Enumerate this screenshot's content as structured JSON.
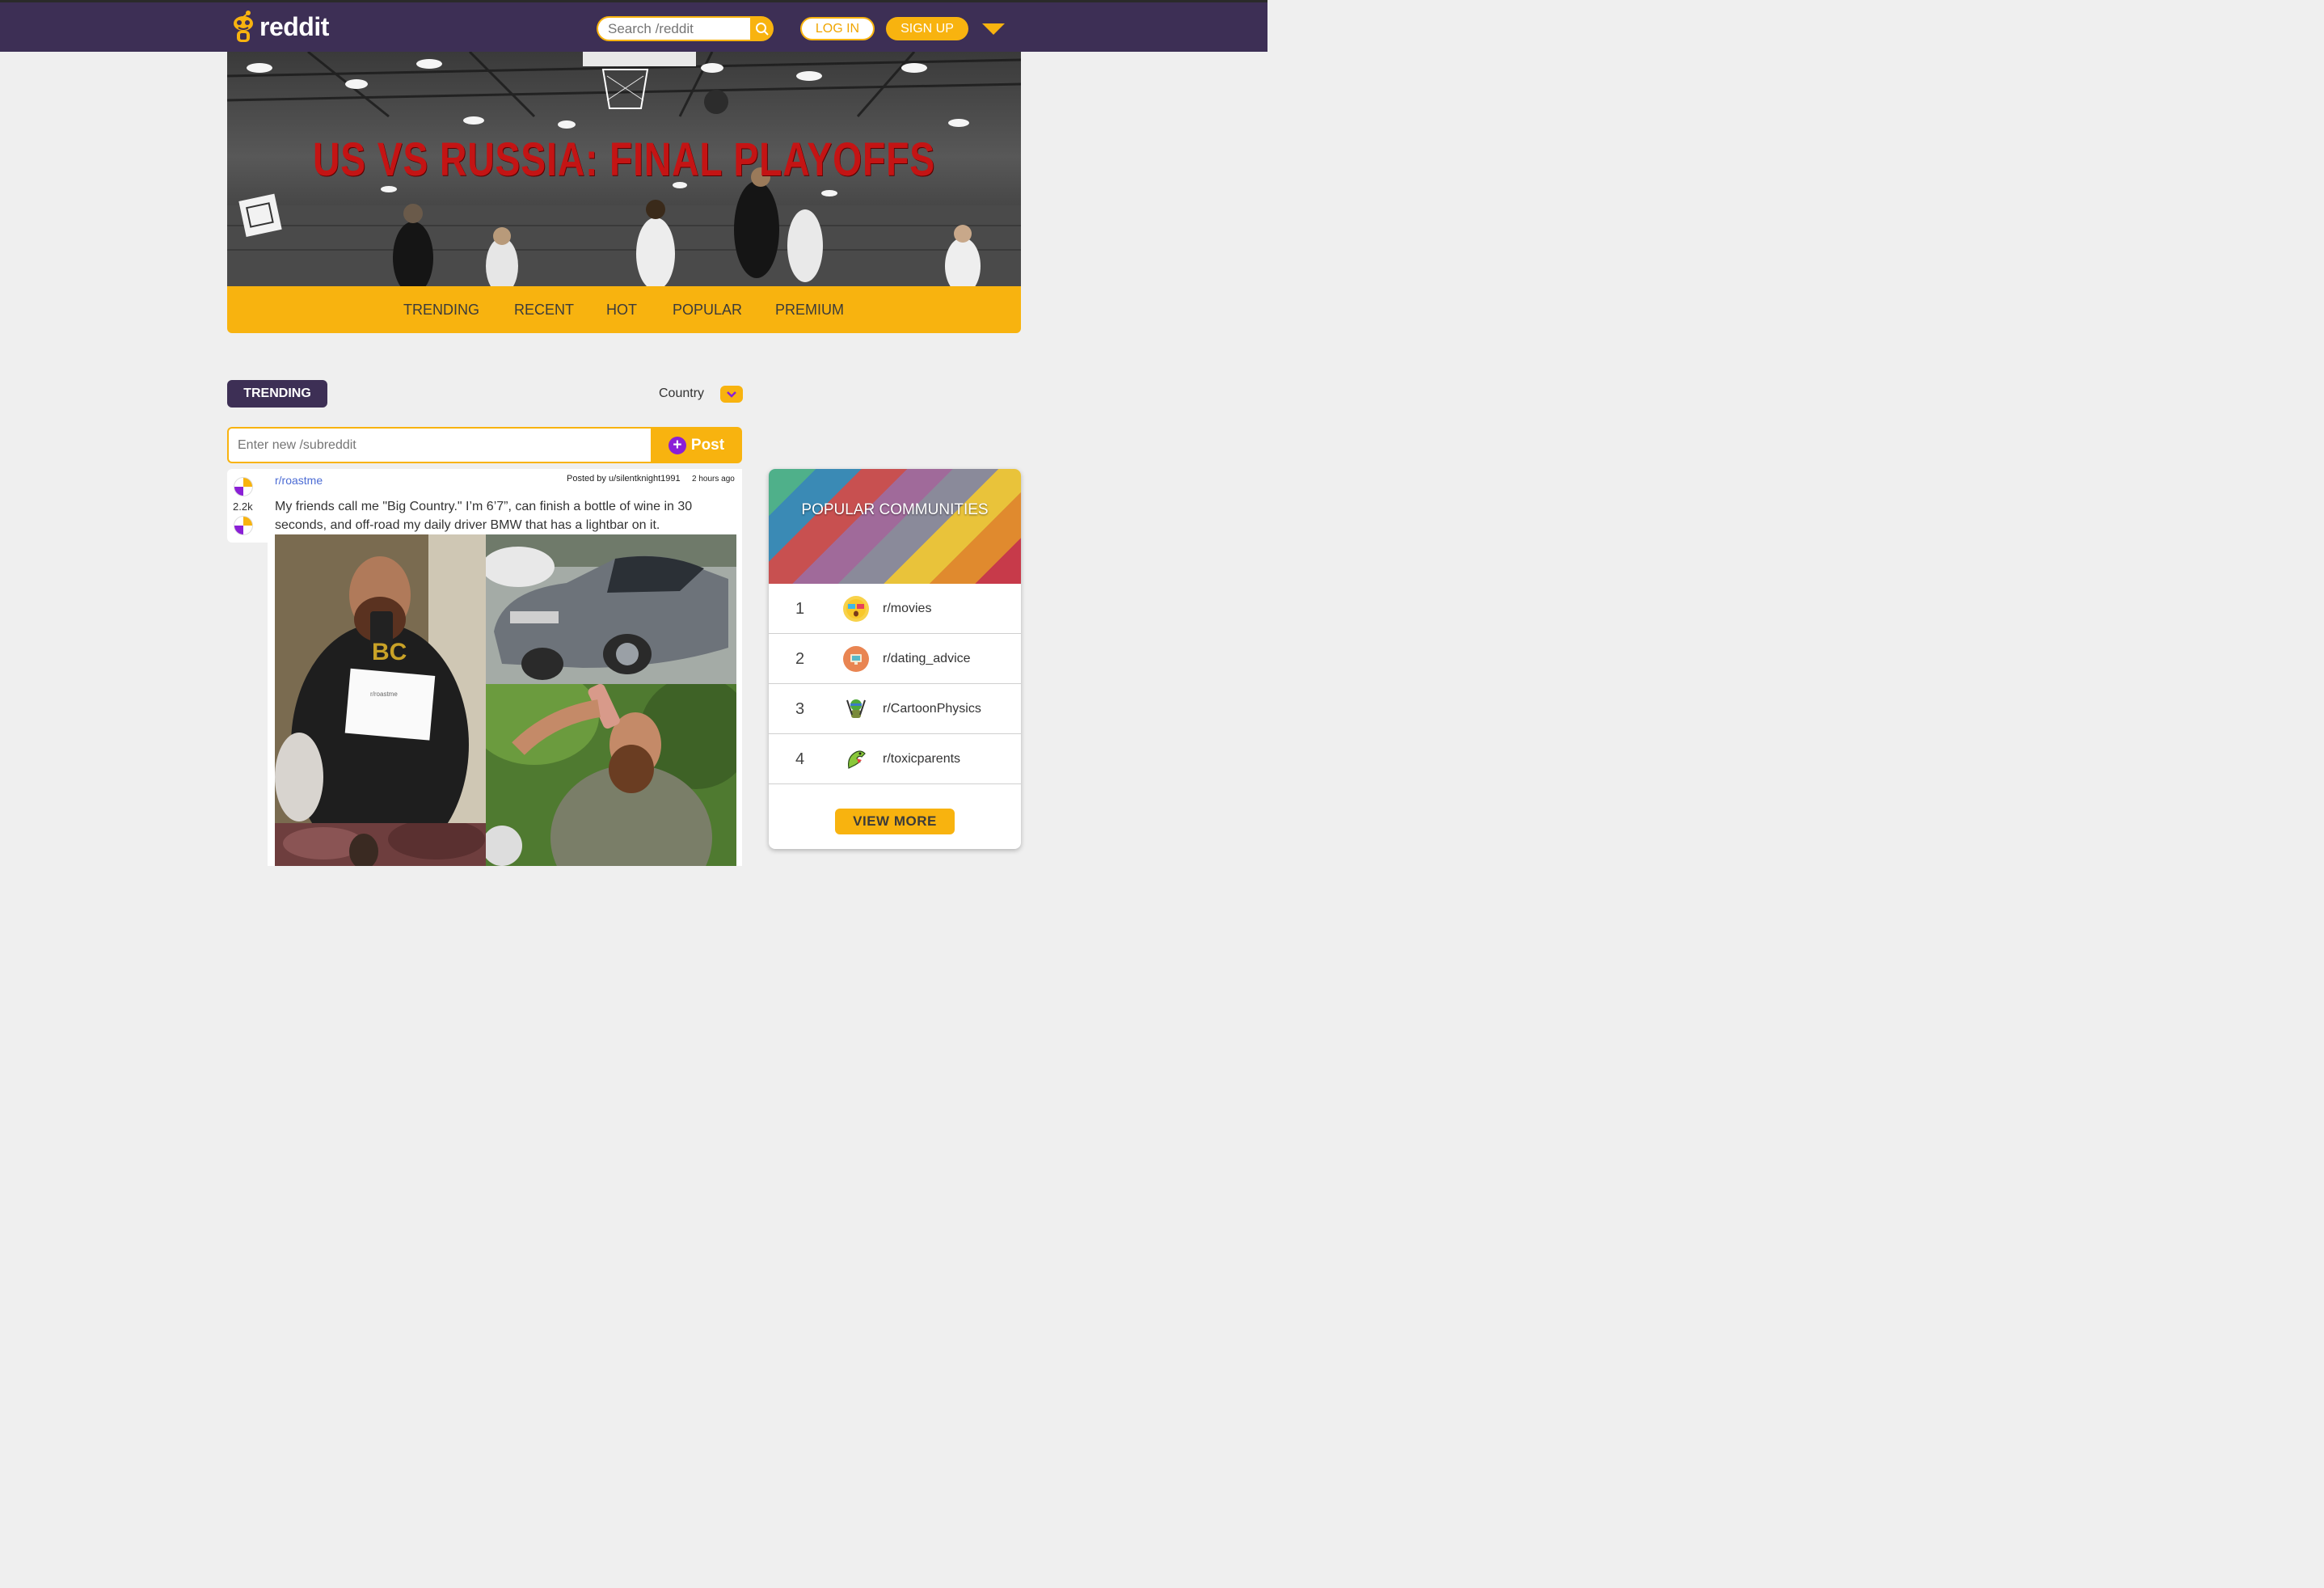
{
  "header": {
    "logo_text": "reddit",
    "search_placeholder": "Search /reddit",
    "login_label": "LOG IN",
    "signup_label": "SIGN UP"
  },
  "banner": {
    "title": "US VS RUSSIA: FINAL PLAYOFFS"
  },
  "nav": {
    "items": [
      "TRENDING",
      "RECENT",
      "HOT",
      "POPULAR",
      "PREMIUM"
    ]
  },
  "feed": {
    "section_label": "TRENDING",
    "filter_label": "Country",
    "new_sub_placeholder": "Enter new /subreddit",
    "post_label": "Post"
  },
  "post": {
    "subreddit": "r/roastme",
    "posted_by": "Posted by u/silentknight1991",
    "time": "2 hours ago",
    "votes": "2.2k",
    "text": "My friends call me \"Big Country.\" I’m 6’7”, can finish a bottle of wine in 30 seconds, and off-road my daily driver BMW that has a lightbar on it."
  },
  "sidebar": {
    "title": "POPULAR COMMUNITIES",
    "communities": [
      {
        "rank": "1",
        "name": "r/movies",
        "icon": "movie-glasses-icon"
      },
      {
        "rank": "2",
        "name": "r/dating_advice",
        "icon": "monitor-icon"
      },
      {
        "rank": "3",
        "name": "r/CartoonPhysics",
        "icon": "ninja-turtle-icon"
      },
      {
        "rank": "4",
        "name": "r/toxicparents",
        "icon": "dragon-icon"
      }
    ],
    "view_more_label": "VIEW MORE"
  },
  "colors": {
    "header_bg": "#3d2f55",
    "accent": "#f8b30f",
    "banner_title": "#c41414",
    "link": "#4b6bd4"
  }
}
